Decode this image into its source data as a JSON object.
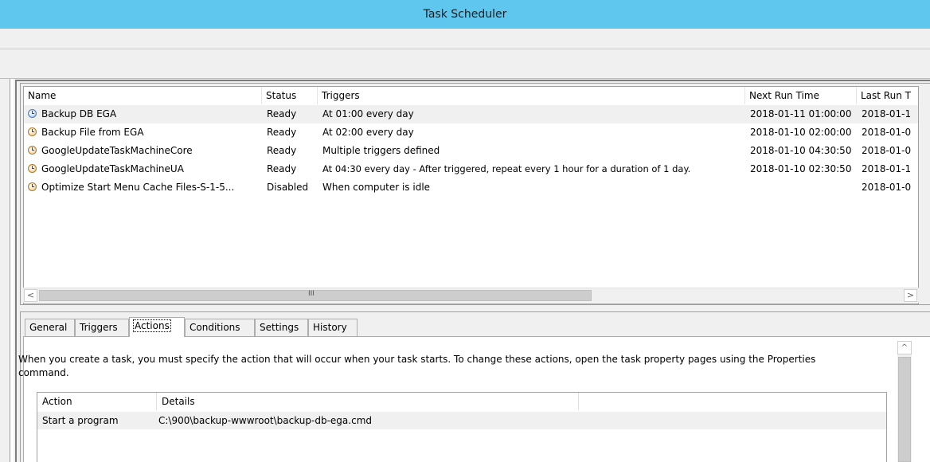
{
  "window": {
    "title": "Task Scheduler"
  },
  "task_list": {
    "columns": [
      "Name",
      "Status",
      "Triggers",
      "Next Run Time",
      "Last Run T"
    ],
    "rows": [
      {
        "name": "Backup DB EGA",
        "status": "Ready",
        "triggers": "At 01:00 every day",
        "next_run": "2018-01-11 01:00:00",
        "last_run": "2018-01-1",
        "icon": "clock-blue-icon",
        "selected": true
      },
      {
        "name": "Backup File from EGA",
        "status": "Ready",
        "triggers": "At 02:00 every day",
        "next_run": "2018-01-10 02:00:00",
        "last_run": "2018-01-0",
        "icon": "clock-orange-icon",
        "selected": false
      },
      {
        "name": "GoogleUpdateTaskMachineCore",
        "status": "Ready",
        "triggers": "Multiple triggers defined",
        "next_run": "2018-01-10 04:30:50",
        "last_run": "2018-01-0",
        "icon": "clock-orange-icon",
        "selected": false
      },
      {
        "name": "GoogleUpdateTaskMachineUA",
        "status": "Ready",
        "triggers": "At 04:30 every day - After triggered, repeat every 1 hour for a duration of 1 day.",
        "next_run": "2018-01-10 02:30:50",
        "last_run": "2018-01-1",
        "icon": "clock-orange-icon",
        "selected": false
      },
      {
        "name": "Optimize Start Menu Cache Files-S-1-5...",
        "status": "Disabled",
        "triggers": "When computer is idle",
        "next_run": "",
        "last_run": "2018-01-0",
        "icon": "clock-orange-icon",
        "selected": false
      }
    ]
  },
  "scrollbar": {
    "grip": "III",
    "left_arrow": "<",
    "right_arrow": ">",
    "up_arrow": "^"
  },
  "tabs": [
    {
      "label": "General",
      "active": false
    },
    {
      "label": "Triggers",
      "active": false
    },
    {
      "label": "Actions",
      "active": true
    },
    {
      "label": "Conditions",
      "active": false
    },
    {
      "label": "Settings",
      "active": false
    },
    {
      "label": "History",
      "active": false
    }
  ],
  "actions_panel": {
    "description": "When you create a task, you must specify the action that will occur when your task starts.  To change these actions, open the task property pages using the Properties command.",
    "columns": [
      "Action",
      "Details"
    ],
    "rows": [
      {
        "action": "Start a program",
        "details": "C:\\900\\backup-wwwroot\\backup-db-ega.cmd"
      }
    ]
  }
}
